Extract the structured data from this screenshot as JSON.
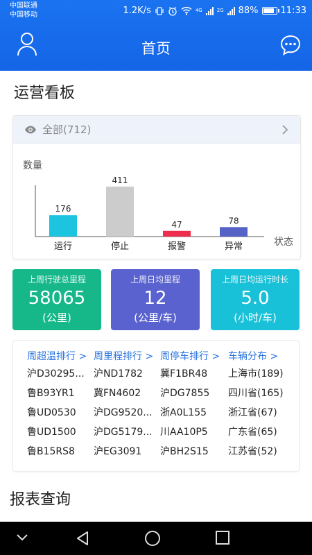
{
  "status_bar": {
    "carrier1": "中国联通",
    "carrier2": "中国移动",
    "speed": "1.2K/s",
    "network": "4G",
    "network2": "2G",
    "battery": "88%",
    "time": "11:33"
  },
  "header": {
    "title": "首页"
  },
  "dashboard": {
    "title": "运营看板"
  },
  "filter": {
    "label": "全部(712)"
  },
  "chart_data": {
    "type": "bar",
    "ylabel": "数量",
    "xlabel": "状态",
    "categories": [
      "运行",
      "停止",
      "报警",
      "异常"
    ],
    "values": [
      176,
      411,
      47,
      78
    ],
    "colors": [
      "#1cc4e0",
      "#cccccc",
      "#ee2c4d",
      "#5562c6"
    ],
    "ylim": [
      0,
      411
    ]
  },
  "stats": [
    {
      "label": "上周行驶总里程",
      "value": "58065",
      "unit": "(公里)"
    },
    {
      "label": "上周日均里程",
      "value": "12",
      "unit": "(公里/车)"
    },
    {
      "label": "上周日均运行时长",
      "value": "5.0",
      "unit": "(小时/车)"
    }
  ],
  "rankings": [
    {
      "header": "周超温排行 >",
      "items": [
        "沪D30295...",
        "鲁B93YR1",
        "鲁UD0530",
        "鲁UD1500",
        "鲁B15RS8"
      ]
    },
    {
      "header": "周里程排行 >",
      "items": [
        "沪ND1782",
        "冀FN4602",
        "沪DG9520...",
        "沪DG5179...",
        "沪EG3091"
      ]
    },
    {
      "header": "周停车排行 >",
      "items": [
        "冀F1BR48",
        "沪DG7855",
        "浙A0L155",
        "川AA10P5",
        "沪BH2S15"
      ]
    },
    {
      "header": "车辆分布 >",
      "items": [
        "上海市(189)",
        "四川省(165)",
        "浙江省(67)",
        "广东省(65)",
        "江苏省(52)"
      ]
    }
  ],
  "report": {
    "title": "报表查询"
  }
}
